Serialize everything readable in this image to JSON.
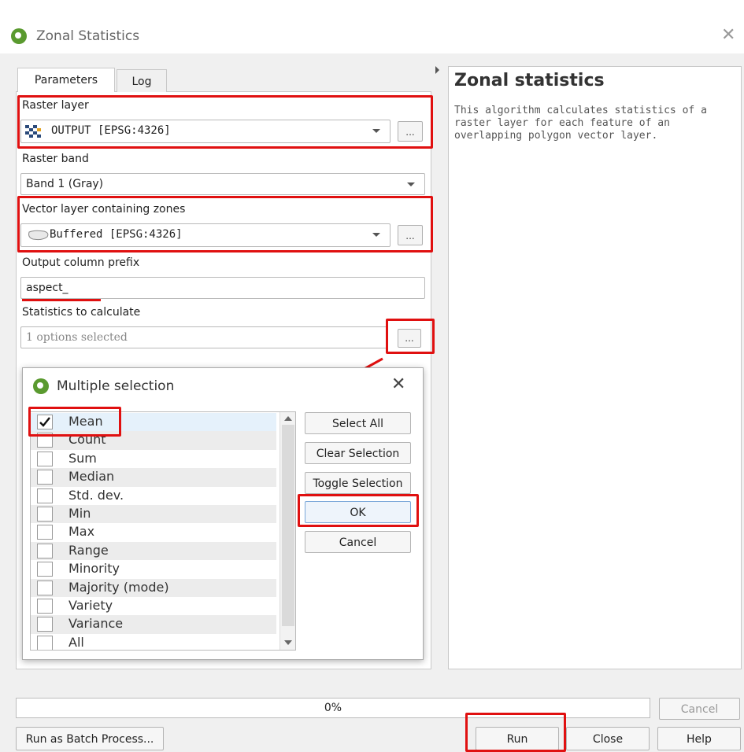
{
  "window": {
    "title": "Zonal Statistics"
  },
  "tabs": {
    "parameters": "Parameters",
    "log": "Log"
  },
  "params": {
    "raster_layer_label": "Raster layer",
    "raster_layer_value": "OUTPUT [EPSG:4326]",
    "raster_band_label": "Raster band",
    "raster_band_value": "Band 1 (Gray)",
    "vector_layer_label": "Vector layer containing zones",
    "vector_layer_value": "Buffered [EPSG:4326]",
    "prefix_label": "Output column prefix",
    "prefix_value": "aspect_",
    "stats_label": "Statistics to calculate",
    "stats_value": "1 options selected",
    "dots": "..."
  },
  "help": {
    "title": "Zonal statistics",
    "body": "This algorithm calculates statistics of a raster layer for each feature of an overlapping polygon vector layer."
  },
  "multi_selection": {
    "title": "Multiple selection",
    "items": [
      {
        "label": "Mean",
        "checked": true
      },
      {
        "label": "Count",
        "checked": false
      },
      {
        "label": "Sum",
        "checked": false
      },
      {
        "label": "Median",
        "checked": false
      },
      {
        "label": "Std. dev.",
        "checked": false
      },
      {
        "label": "Min",
        "checked": false
      },
      {
        "label": "Max",
        "checked": false
      },
      {
        "label": "Range",
        "checked": false
      },
      {
        "label": "Minority",
        "checked": false
      },
      {
        "label": "Majority (mode)",
        "checked": false
      },
      {
        "label": "Variety",
        "checked": false
      },
      {
        "label": "Variance",
        "checked": false
      },
      {
        "label": "All",
        "checked": false
      }
    ],
    "select_all": "Select All",
    "clear_selection": "Clear Selection",
    "toggle_selection": "Toggle Selection",
    "ok": "OK",
    "cancel": "Cancel"
  },
  "footer": {
    "progress_text": "0%",
    "progress_value": 0,
    "cancel": "Cancel",
    "batch": "Run as Batch Process...",
    "run": "Run",
    "close": "Close",
    "help": "Help"
  },
  "colors": {
    "highlight": "#e01010",
    "qgis_green": "#5a9a2f"
  }
}
